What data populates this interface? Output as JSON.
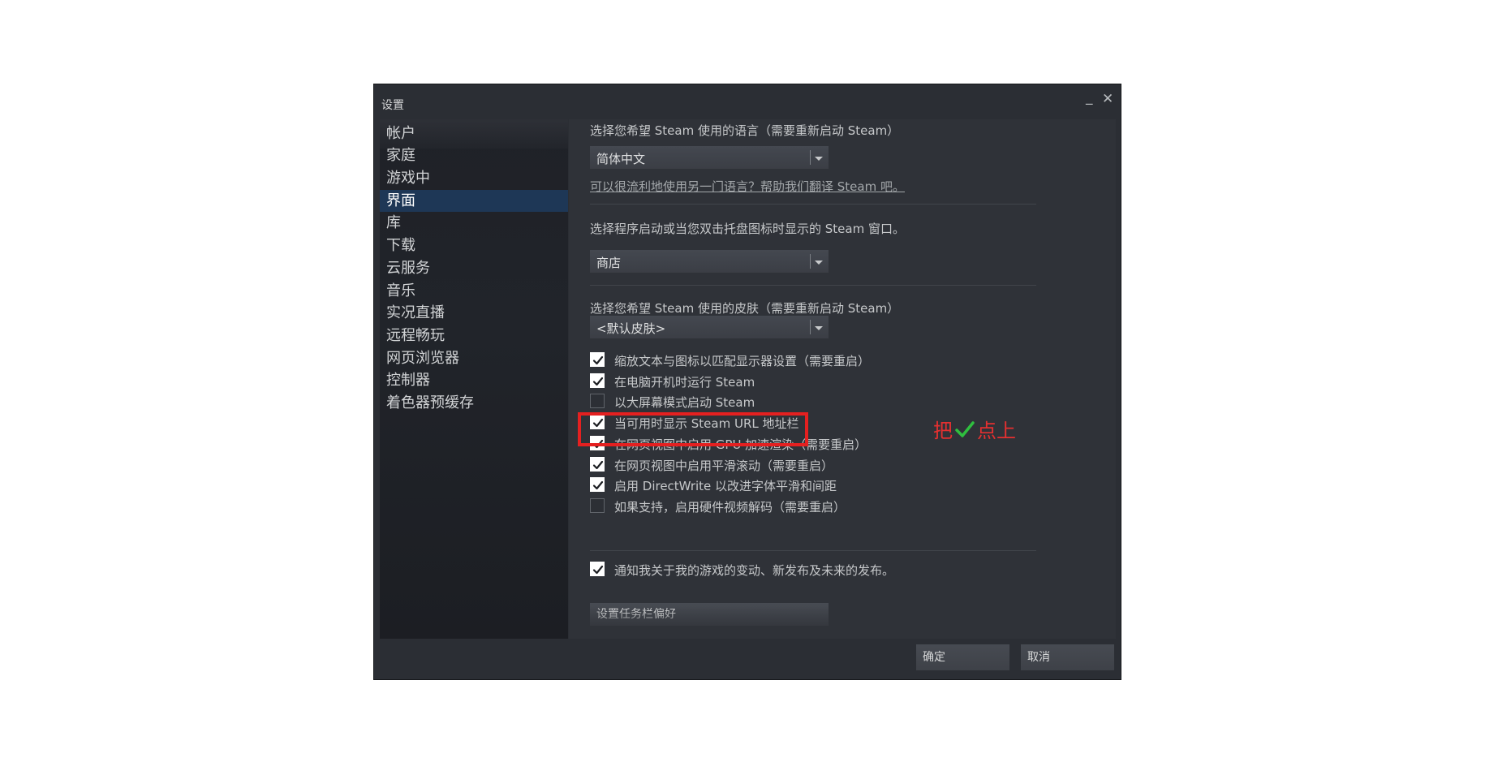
{
  "window": {
    "title": "设置",
    "minimize_glyph": "_",
    "close_glyph": "✕"
  },
  "sidebar": {
    "items": [
      {
        "label": "帐户",
        "active": false
      },
      {
        "label": "家庭",
        "active": false
      },
      {
        "label": "游戏中",
        "active": false
      },
      {
        "label": "界面",
        "active": true
      },
      {
        "label": "库",
        "active": false
      },
      {
        "label": "下载",
        "active": false
      },
      {
        "label": "云服务",
        "active": false
      },
      {
        "label": "音乐",
        "active": false
      },
      {
        "label": "实况直播",
        "active": false
      },
      {
        "label": "远程畅玩",
        "active": false
      },
      {
        "label": "网页浏览器",
        "active": false
      },
      {
        "label": "控制器",
        "active": false
      },
      {
        "label": "着色器预缓存",
        "active": false
      }
    ]
  },
  "content": {
    "language": {
      "label": "选择您希望 Steam 使用的语言（需要重新启动 Steam）",
      "selected": "简体中文",
      "help_link": "可以很流利地使用另一门语言？帮助我们翻译 Steam 吧。"
    },
    "start_window": {
      "label": "选择程序启动或当您双击托盘图标时显示的 Steam 窗口。",
      "selected": "商店"
    },
    "skin": {
      "label": "选择您希望 Steam 使用的皮肤（需要重新启动 Steam）",
      "selected": "<默认皮肤>"
    },
    "checkboxes": [
      {
        "label": "缩放文本与图标以匹配显示器设置（需要重启）",
        "checked": true
      },
      {
        "label": "在电脑开机时运行 Steam",
        "checked": true
      },
      {
        "label": "以大屏幕模式启动 Steam",
        "checked": false
      },
      {
        "label": "当可用时显示 Steam URL 地址栏",
        "checked": true
      },
      {
        "label": "在网页视图中启用 GPU 加速渲染（需要重启）",
        "checked": true
      },
      {
        "label": "在网页视图中启用平滑滚动（需要重启）",
        "checked": true
      },
      {
        "label": "启用 DirectWrite 以改进字体平滑和间距",
        "checked": true
      },
      {
        "label": "如果支持，启用硬件视频解码（需要重启）",
        "checked": false
      }
    ],
    "notify": {
      "label": "通知我关于我的游戏的变动、新发布及未来的发布。",
      "checked": true
    },
    "taskbar_button": "设置任务栏偏好"
  },
  "footer": {
    "ok_button": "确定",
    "cancel_button": "取消"
  },
  "annotation": {
    "before": "把",
    "after": "点上",
    "text_color": "#e53030",
    "tick_color": "#2fbf3f",
    "box_color": "#e52020"
  },
  "colors": {
    "window_bg": "#2b2e34",
    "active_nav": "#1e3756"
  }
}
